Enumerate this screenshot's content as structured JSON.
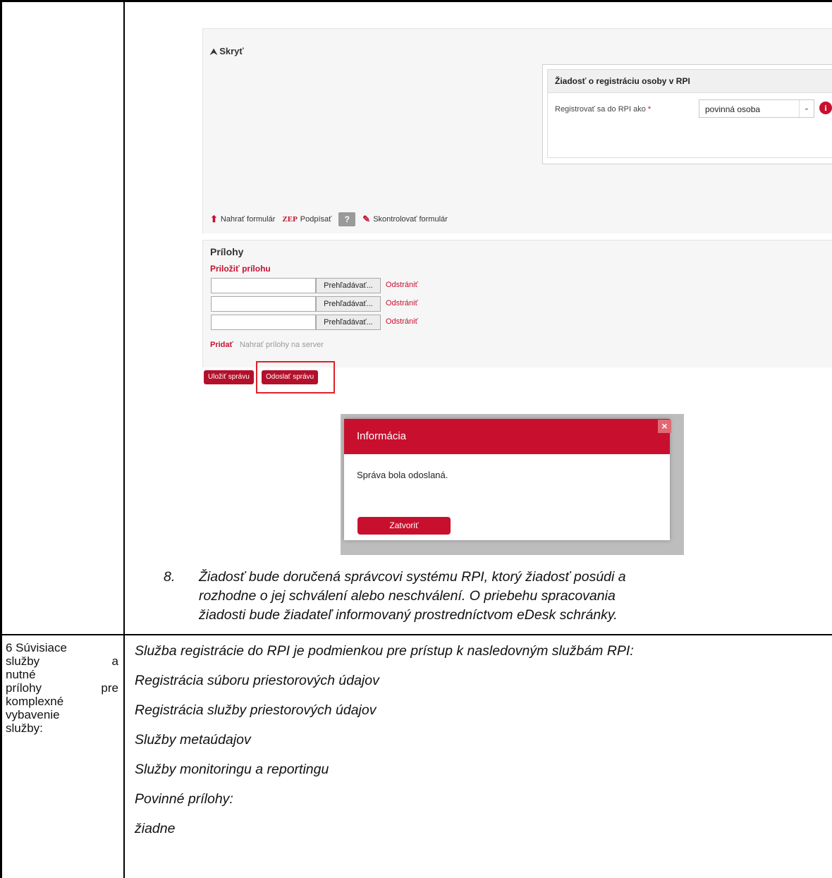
{
  "form": {
    "hide_link": "Skryť",
    "registration_box_title": "Žiadosť o registráciu osoby v RPI",
    "register_as_label": "Registrovať sa do RPI ako",
    "required_mark": "*",
    "register_as_value": "povinná osoba",
    "info_icon_glyph": "i",
    "toolbar": {
      "upload_form": "Nahrať formulár",
      "sign_icon_glyph": "ZEP",
      "sign": "Podpísať",
      "help": "?",
      "check_form": "Skontrolovať formulár"
    }
  },
  "attachments": {
    "title": "Prílohy",
    "attach_link": "Priložiť prílohu",
    "rows": [
      {
        "browse": "Prehľadávať...",
        "remove": "Odstrániť"
      },
      {
        "browse": "Prehľadávať...",
        "remove": "Odstrániť"
      },
      {
        "browse": "Prehľadávať...",
        "remove": "Odstrániť"
      }
    ],
    "add_link": "Pridať",
    "upload_to_server": "Nahrať prílohy na server"
  },
  "actions": {
    "save_message": "Uložiť správu",
    "send_message": "Odoslať správu"
  },
  "dialog": {
    "title": "Informácia",
    "close_glyph": "×",
    "message": "Správa bola odoslaná.",
    "close_button": "Zatvoriť"
  },
  "step8": {
    "number": "8.",
    "lines": [
      "Žiadosť bude doručená správcovi systému RPI, ktorý žiadosť posúdi a",
      "rozhodne o jej schválení alebo neschválení. O priebehu spracovania",
      "žiadosti bude žiadateľ informovaný prostredníctvom eDesk schránky."
    ]
  },
  "row6": {
    "label_lines": [
      "6 Súvisiace",
      "služby a",
      "nutné",
      "prílohy pre",
      "komplexné",
      "vybavenie",
      "služby:"
    ],
    "items": [
      "Služba registrácie do RPI je podmienkou pre prístup k nasledovným službám RPI:",
      "Registrácia súboru priestorových údajov",
      "Registrácia služby priestorových údajov",
      "Služby metaúdajov",
      "Služby monitoringu a reportingu",
      "Povinné prílohy:",
      "žiadne"
    ]
  },
  "colors": {
    "accent": "#c8102e",
    "highlight": "#e0202a"
  }
}
